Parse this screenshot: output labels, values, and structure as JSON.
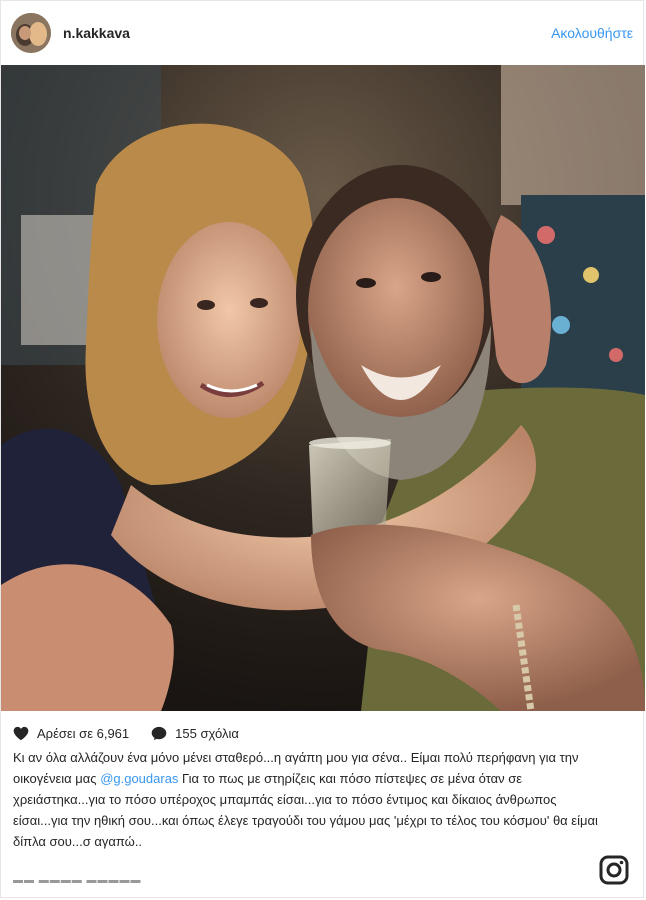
{
  "header": {
    "username": "n.kakkava",
    "follow_label": "Ακολουθήστε"
  },
  "actions": {
    "likes_text": "Αρέσει σε 6,961",
    "comments_text": "155 σχόλια",
    "like_icon": "heart-icon",
    "comment_icon": "speech-bubble-icon"
  },
  "caption": {
    "part1": "Κι αν όλα αλλάζουν ένα μόνο μένει σταθερό...η αγάπη μου για σένα.. Είμαι πολύ περήφανη για την οικογένεια μας ",
    "mention": "@g.goudaras",
    "part2": " Για το πως με στηρίζεις και πόσο πίστεψες σε μένα όταν σε χρειάστηκα...για το πόσο υπέροχος μπαμπάς είσαι...για το πόσο έντιμος και δίκαιος άνθρωπος είσαι...για την ηθική σου...και όπως έλεγε τραγούδι του γάμου μας 'μέχρι το τέλος του κόσμου' θα είμαι δίπλα σου...σ αγαπώ.."
  },
  "footer": {
    "logo_icon": "instagram-logo-icon"
  },
  "colors": {
    "accent": "#3897f0",
    "text": "#262626"
  }
}
